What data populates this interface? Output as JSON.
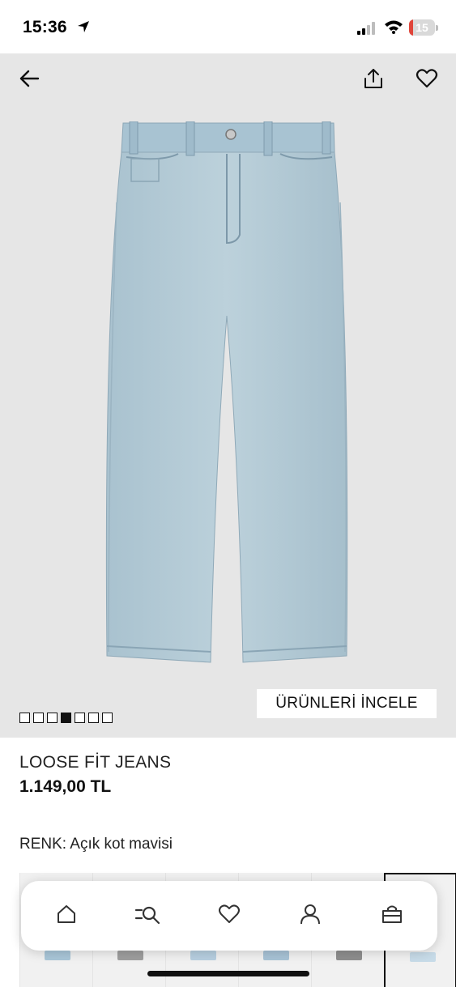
{
  "status_bar": {
    "time": "15:36",
    "battery_level": "15",
    "battery_fraction": 0.15,
    "battery_color": "#e0453a",
    "icons": [
      "location-arrow-icon",
      "cellular-signal-icon",
      "wifi-icon",
      "battery-icon"
    ]
  },
  "header": {
    "icons": [
      "back-arrow-icon",
      "share-icon",
      "heart-icon"
    ]
  },
  "gallery": {
    "image_count": 7,
    "current_index": 3,
    "inspect_label": "ÜRÜNLERİ İNCELE"
  },
  "product": {
    "name": "LOOSE FİT JEANS",
    "price": "1.149,00 TL",
    "color_label": "RENK: Açık kot mavisi"
  },
  "swatches": {
    "colors": [
      "#a9c6d8",
      "#9e9e9e",
      "#b7cfe0",
      "#a8c3d6",
      "#8e8e8e",
      "#c7dbe8"
    ],
    "selected_index": 5
  },
  "bottom_nav": {
    "items": [
      "home-icon",
      "search-icon",
      "heart-icon",
      "profile-icon",
      "bag-icon"
    ]
  },
  "colors": {
    "hero_background": "#e6e6e6",
    "denim": "#b3cad5"
  }
}
